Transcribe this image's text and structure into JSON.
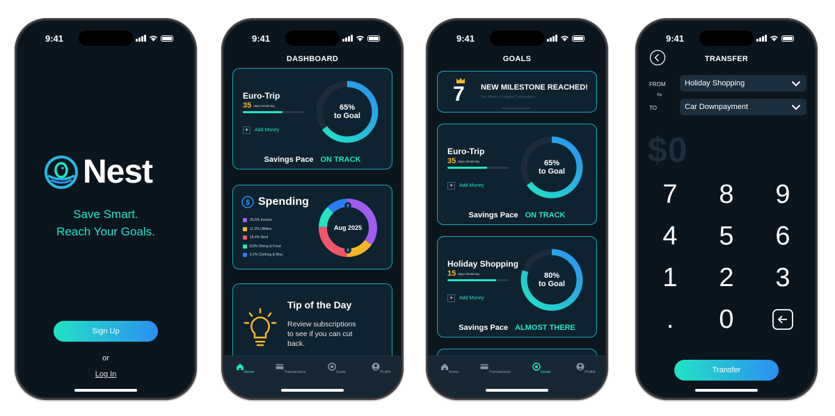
{
  "status_time": "9:41",
  "welcome": {
    "logo_text": "Nest",
    "tagline_line1": "Save Smart.",
    "tagline_line2": "Reach Your Goals.",
    "signup_label": "Sign Up",
    "or_text": "or",
    "login_label": "Log In"
  },
  "dashboard": {
    "title": "DASHBOARD",
    "goal": {
      "name": "Euro-Trip",
      "days": "35",
      "days_label": "days remaining",
      "progress": 0.65,
      "add_money": "Add Money",
      "percent": "65%",
      "to_goal": "to Goal",
      "pace_label": "Savings Pace",
      "pace_status": "ON TRACK"
    },
    "spending": {
      "title": "Spending",
      "center_label": "Aug 2025",
      "items": [
        {
          "label": "25.6% Income",
          "color": "#a05cf0",
          "value": 25.6
        },
        {
          "label": "11.3% Utilities",
          "color": "#f7b62a",
          "value": 11.3
        },
        {
          "label": "18.4% Rent",
          "color": "#f0556b",
          "value": 18.4
        },
        {
          "label": "8.8% Dining & Food",
          "color": "#22e4c4",
          "value": 8.8
        },
        {
          "label": "9.2% Clothing & Misc.",
          "color": "#2f7cf0",
          "value": 9.2
        }
      ]
    },
    "tip": {
      "title": "Tip of the Day",
      "line1": "Review subscriptions",
      "line2": "to see if you can cut",
      "line3": "back."
    }
  },
  "tabs": [
    {
      "label": "Home",
      "icon": "home-icon"
    },
    {
      "label": "Transactions",
      "icon": "card-icon"
    },
    {
      "label": "Goals",
      "icon": "target-icon"
    },
    {
      "label": "Profile",
      "icon": "profile-icon"
    }
  ],
  "goals": {
    "title": "GOALS",
    "milestone": {
      "number": "7",
      "title": "NEW MILESTONE REACHED!",
      "subtitle": "One Week of Logging Transactions."
    },
    "cards": [
      {
        "name": "Euro-Trip",
        "days": "35",
        "days_label": "days remaining",
        "progress": 0.65,
        "add_money": "Add Money",
        "percent": "65%",
        "to_goal": "to Goal",
        "pace_label": "Savings Pace",
        "pace_status": "ON TRACK"
      },
      {
        "name": "Holiday Shopping",
        "days": "15",
        "days_label": "days remaining",
        "progress": 0.8,
        "add_money": "Add Money",
        "percent": "80%",
        "to_goal": "to Goal",
        "pace_label": "Savings Pace",
        "pace_status": "ALMOST THERE"
      }
    ]
  },
  "transfer": {
    "title": "TRANSFER",
    "from_label": "FROM",
    "to_label": "TO",
    "from_value": "Holiday Shopping",
    "to_value": "Car Downpayment",
    "amount": "$0",
    "keys": [
      "7",
      "8",
      "9",
      "4",
      "5",
      "6",
      "1",
      "2",
      "3",
      ".",
      "0"
    ],
    "submit_label": "Transfer"
  },
  "colors": {
    "accent": "#22e4c4",
    "accent_blue": "#2c8ff0",
    "bg": "#0b151e",
    "card_border": "#1aa9b8",
    "amber": "#f7b62a"
  }
}
